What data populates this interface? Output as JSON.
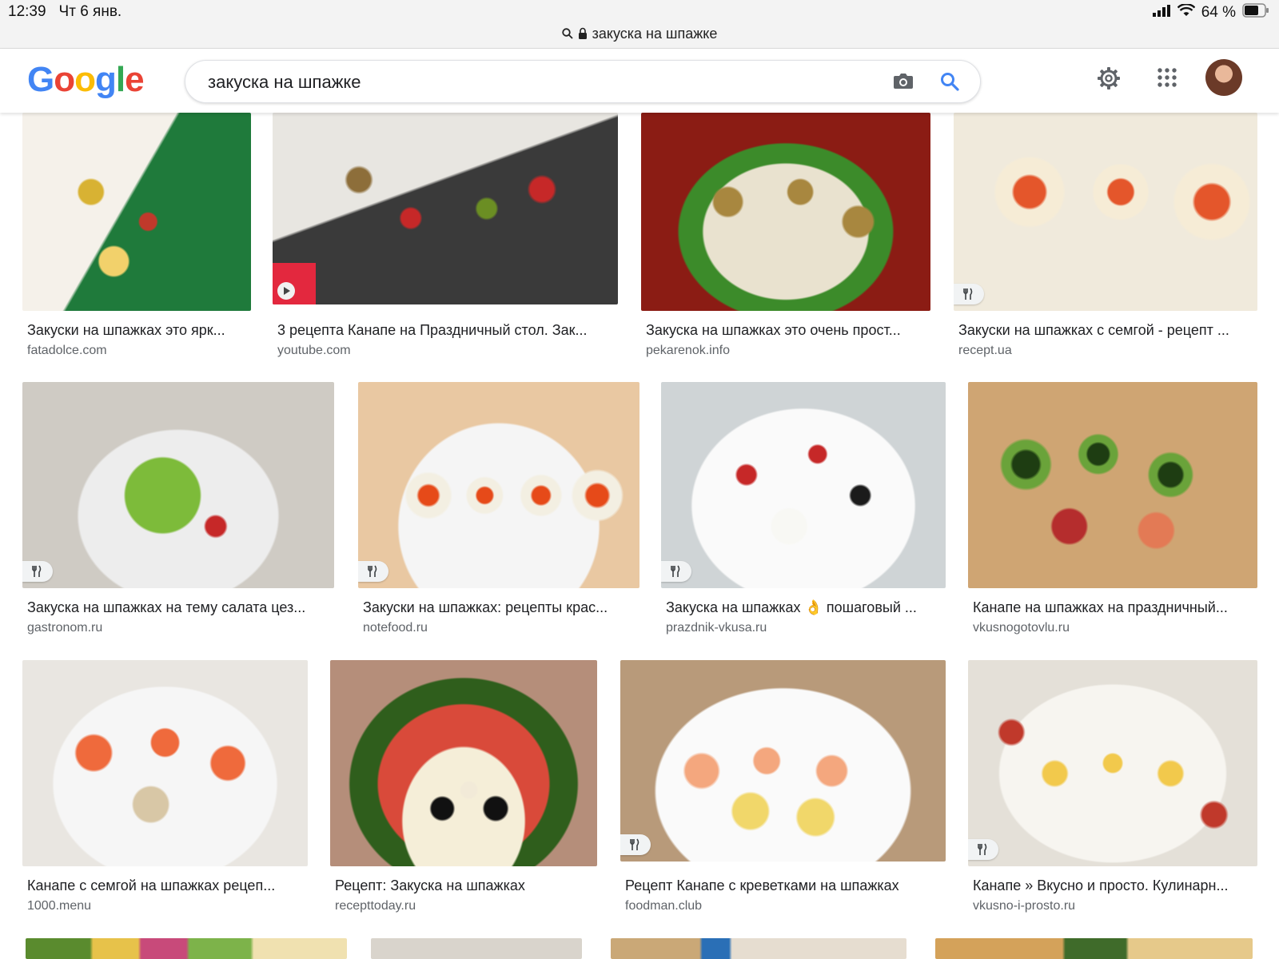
{
  "status": {
    "time": "12:39",
    "date": "Чт 6 янв.",
    "battery": "64 %",
    "url": "закуска на шпажке"
  },
  "header": {
    "logo": [
      "G",
      "o",
      "o",
      "g",
      "l",
      "e"
    ],
    "query": "закуска на шпажке"
  },
  "results": [
    {
      "title": "Закуски на шпажках это ярк...",
      "domain": "fatadolce.com"
    },
    {
      "title": "3 рецепта Канапе на Праздничный стол. Зак...",
      "domain": "youtube.com"
    },
    {
      "title": "Закуска на шпажках это очень прост...",
      "domain": "pekarenok.info"
    },
    {
      "title": "Закуски на шпажках с семгой - рецепт ...",
      "domain": "recept.ua"
    },
    {
      "title": "Закуска на шпажках на тему салата цез...",
      "domain": "gastronom.ru"
    },
    {
      "title": "Закуски на шпажках: рецепты крас...",
      "domain": "notefood.ru"
    },
    {
      "title": "Закуска на шпажках 👌 пошаговый ...",
      "domain": "prazdnik-vkusa.ru"
    },
    {
      "title": "Канапе на шпажках на праздничный...",
      "domain": "vkusnogotovlu.ru"
    },
    {
      "title": "Канапе с семгой на шпажках рецеп...",
      "domain": "1000.menu"
    },
    {
      "title": "Рецепт: Закуска на шпажках",
      "domain": "recepttoday.ru"
    },
    {
      "title": "Рецепт Канапе с креветками на шпажках",
      "domain": "foodman.club"
    },
    {
      "title": "Канапе » Вкусно и просто. Кулинарн...",
      "domain": "vkusno-i-prosto.ru"
    }
  ]
}
